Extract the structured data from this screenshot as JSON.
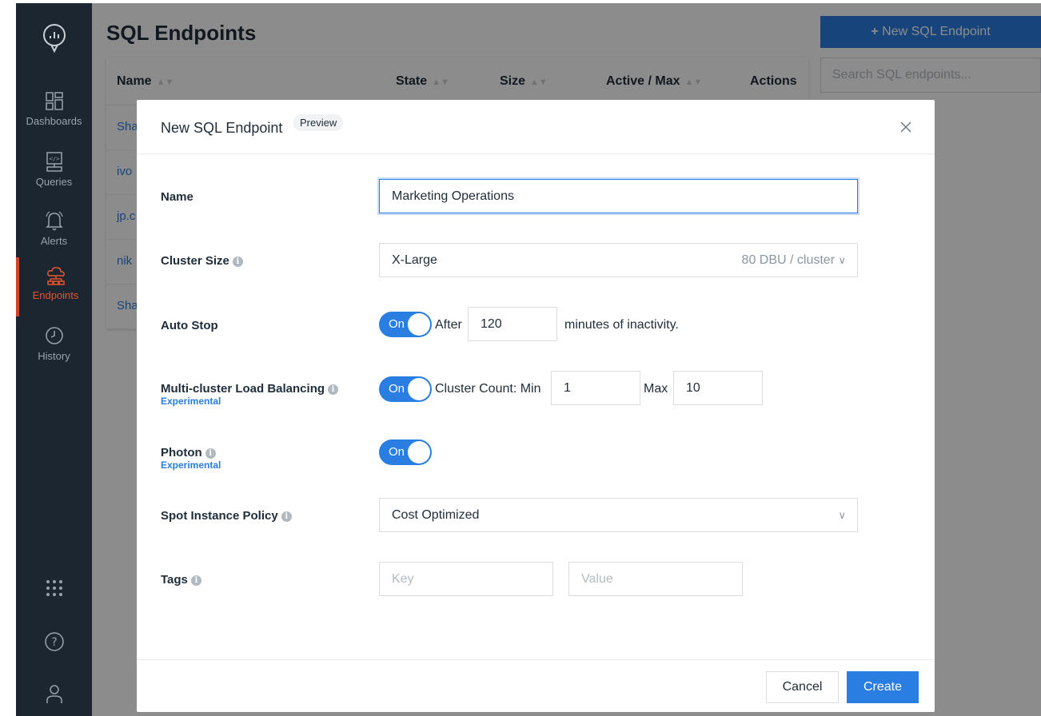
{
  "sidebar": {
    "logo": "databricks-sql-logo",
    "items": [
      {
        "label": "Dashboards",
        "icon": "dashboards-icon"
      },
      {
        "label": "Queries",
        "icon": "queries-icon"
      },
      {
        "label": "Alerts",
        "icon": "bell-icon"
      },
      {
        "label": "Endpoints",
        "icon": "endpoints-icon"
      },
      {
        "label": "History",
        "icon": "clock-icon"
      }
    ],
    "bottom_icons": [
      "apps-grid-icon",
      "help-icon",
      "user-icon"
    ]
  },
  "page": {
    "title": "SQL Endpoints",
    "new_button": "New SQL Endpoint",
    "search_placeholder": "Search SQL endpoints...",
    "table": {
      "headers": [
        "Name",
        "State",
        "Size",
        "Active / Max",
        "Actions"
      ],
      "rows": [
        "Sha",
        "ivo",
        "jp.c",
        "nik",
        "Sha"
      ]
    }
  },
  "modal": {
    "title": "New SQL Endpoint",
    "tag": "Preview",
    "fields": {
      "name": {
        "label": "Name",
        "value": "Marketing Operations"
      },
      "cluster_size": {
        "label": "Cluster Size",
        "value": "X-Large",
        "suffix": "80 DBU / cluster"
      },
      "auto_stop": {
        "label": "Auto Stop",
        "toggle": "On",
        "after": "After",
        "minutes": "120",
        "suffix": "minutes of inactivity."
      },
      "multi_cluster": {
        "label": "Multi-cluster Load Balancing",
        "sub": "Experimental",
        "toggle": "On",
        "count_label": "Cluster Count: Min",
        "min": "1",
        "max_label": "Max",
        "max": "10"
      },
      "photon": {
        "label": "Photon",
        "sub": "Experimental",
        "toggle": "On"
      },
      "spot": {
        "label": "Spot Instance Policy",
        "value": "Cost Optimized"
      },
      "tags": {
        "label": "Tags",
        "key_placeholder": "Key",
        "value_placeholder": "Value"
      }
    },
    "cancel": "Cancel",
    "create": "Create"
  },
  "colors": {
    "accent": "#2a7de1",
    "sidebar": "#1c2630",
    "active": "#e3542e"
  }
}
